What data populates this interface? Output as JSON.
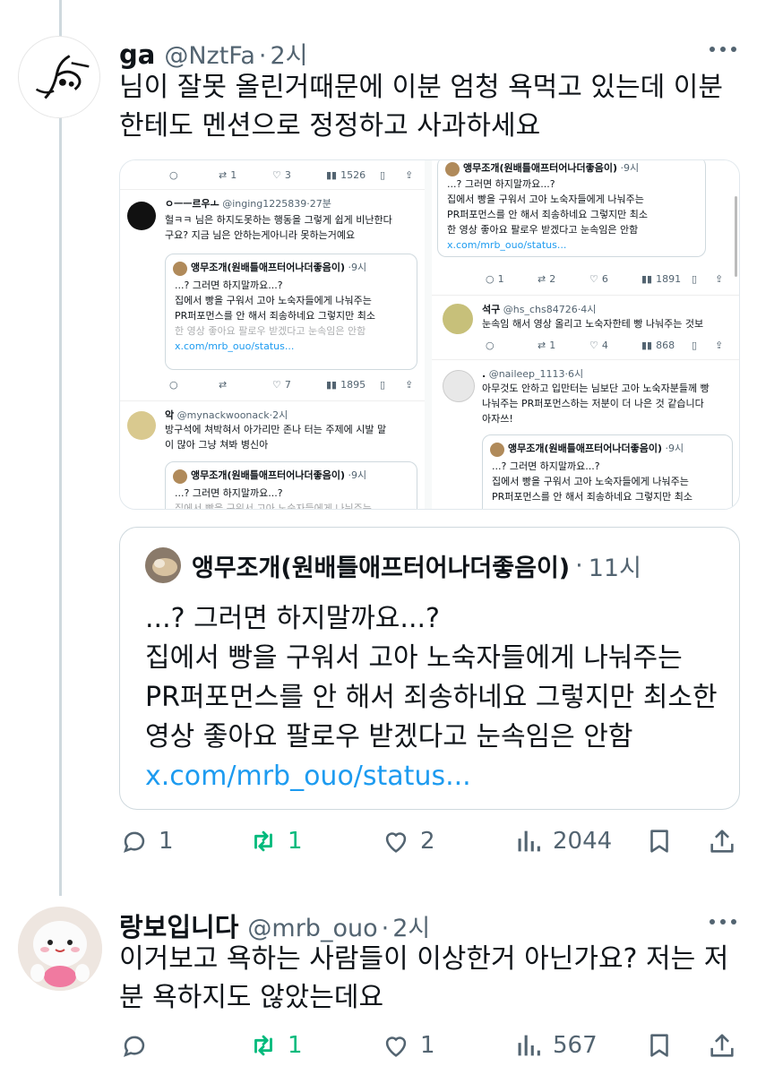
{
  "tweet1": {
    "name": "ga",
    "handle": "@NztFa",
    "time": "2시",
    "text_lines": [
      "님이 잘못 올린거때문에 이분 엄청 욕먹고 있는데 이분",
      "한테도 멘션으로 정정하고 사과하세요"
    ],
    "embedded_image": {
      "left": {
        "top_actions": {
          "replies": "",
          "retweets": "1",
          "likes": "3",
          "views": "1526"
        },
        "reply1": {
          "name": "ㅇㅡㅡ르우ㅗ",
          "handle": "@inging1225839",
          "time": "27분",
          "lines": [
            "헐ㅋㅋ 님은 하지도못하는 행동을 그렇게 쉽게 비난한다",
            "구요? 지금 님은 안하는게아니라 못하는거예요"
          ]
        },
        "quote1": {
          "name": "앵무조개(원배틀애프터어나더좋음이)",
          "time": "9시",
          "lines": [
            "...? 그러면 하지말까요...?",
            "집에서 빵을 구워서 고아 노숙자들에게 나눠주는",
            "PR퍼포먼스를 안 해서 죄송하네요 그렇지만 최소",
            "한 영상 좋아요 팔로우 받겠다고 눈속임은 안함"
          ],
          "link": "x.com/mrb_ouo/status..."
        },
        "mid_actions": {
          "replies": "",
          "retweets": "",
          "likes": "7",
          "views": "1895"
        },
        "reply2": {
          "name": "악",
          "handle": "@mynackwoonack",
          "time": "2시",
          "lines": [
            "방구석에 쳐박혀서 아가리만 존나 터는 주제에 시발 말",
            "이 많아 그냥 쳐봐 병신아"
          ]
        },
        "quote2": {
          "name": "앵무조개(원배틀애프터어나더좋음이)",
          "time": "9시",
          "lines": [
            "...? 그러면 하지말까요...?",
            "집에서 빵을 구워서 고아 노숙자들에게 나눠주는"
          ]
        }
      },
      "right": {
        "quote1": {
          "name": "앵무조개(원배틀애프터어나더좋음이)",
          "time": "9시",
          "lines": [
            "...? 그러면 하지말까요...?",
            "집에서 빵을 구워서 고아 노숙자들에게 나눠주는",
            "PR퍼포먼스를 안 해서 죄송하네요 그렇지만 최소",
            "한 영상 좋아요 팔로우 받겠다고 눈속임은 안함"
          ],
          "link": "x.com/mrb_ouo/status..."
        },
        "actions1": {
          "replies": "1",
          "retweets": "2",
          "likes": "6",
          "views": "1891"
        },
        "reply1": {
          "name": "석구",
          "handle": "@hs_chs84726",
          "time": "4시",
          "line": "눈속임 해서 영상 올리고 노숙자한테 빵 나눠주는 것보"
        },
        "actions2": {
          "replies": "",
          "retweets": "1",
          "likes": "4",
          "views": "868"
        },
        "reply2": {
          "name": ".",
          "handle": "@naileep_1113",
          "time": "6시",
          "lines": [
            "아무것도 안하고 입만터는 님보단 고아 노숙자분들께 빵",
            "나눠주는 PR퍼포먼스하는 저분이 더 나은 것 같습니다",
            "아자쓰!"
          ]
        },
        "quote2": {
          "name": "앵무조개(원배틀애프터어나더좋음이)",
          "time": "9시",
          "lines": [
            "...? 그러면 하지말까요...?",
            "집에서 빵을 구워서 고아 노숙자들에게 나눠주는",
            "PR퍼포먼스를 안 해서 죄송하네요 그렇지만 최소"
          ]
        }
      }
    },
    "quote": {
      "name": "앵무조개(원배틀애프터어나더좋음이)",
      "time": "11시",
      "lines": [
        "...? 그러면 하지말까요...?",
        "집에서 빵을 구워서 고아 노숙자들에게 나눠주는",
        "PR퍼포먼스를 안 해서 죄송하네요 그렇지만 최소한",
        "영상 좋아요 팔로우 받겠다고 눈속임은 안함"
      ],
      "link": "x.com/mrb_ouo/status..."
    },
    "actions": {
      "replies": "1",
      "retweets": "1",
      "likes": "2",
      "views": "2044"
    }
  },
  "tweet2": {
    "name": "랑보입니다",
    "handle": "@mrb_ouo",
    "time": "2시",
    "text_lines": [
      "이거보고 욕하는 사람들이 이상한거 아닌가요? 저는 저",
      "분 욕하지도 않았는데요"
    ],
    "actions": {
      "replies": "",
      "retweets": "1",
      "likes": "1",
      "views": "567"
    }
  },
  "icons": [
    "reply-icon",
    "retweet-icon",
    "like-icon",
    "views-icon",
    "bookmark-icon",
    "share-icon",
    "more-icon"
  ],
  "colors": {
    "text": "#0f1419",
    "muted": "#536471",
    "link": "#1d9bf0",
    "retweet_active": "#00ba7c",
    "border": "#cfd9de"
  }
}
